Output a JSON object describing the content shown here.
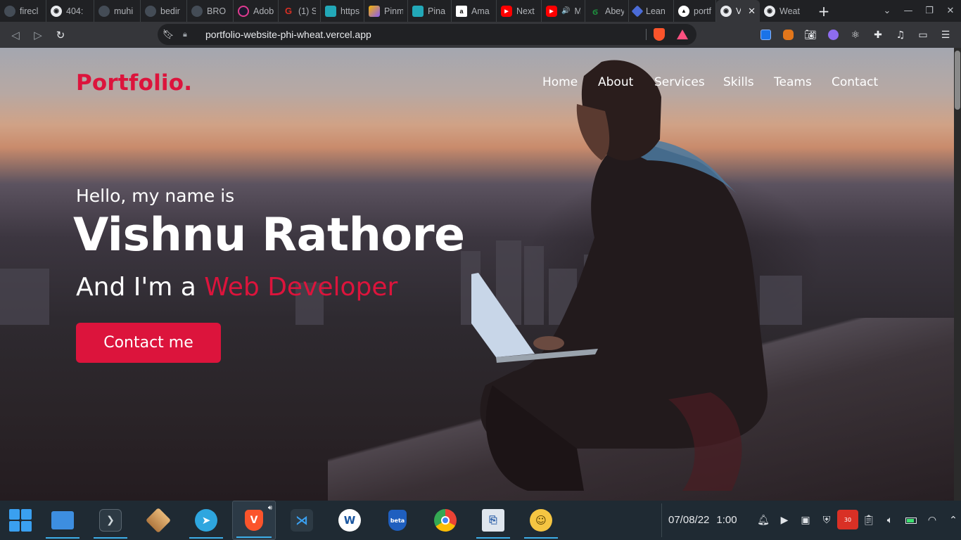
{
  "browser": {
    "tabs": [
      {
        "label": "firecl",
        "icon": "github-icon",
        "color": "#444c56"
      },
      {
        "label": "404:",
        "icon": "globe-icon",
        "color": "#5f6368"
      },
      {
        "label": "muhi",
        "icon": "github-icon",
        "color": "#444c56"
      },
      {
        "label": "bedir",
        "icon": "github-icon",
        "color": "#444c56"
      },
      {
        "label": "BRO",
        "icon": "github-icon",
        "color": "#444c56"
      },
      {
        "label": "Adob",
        "icon": "adobe-icon",
        "color": "#1a1a2e"
      },
      {
        "label": "(1) S",
        "icon": "g-icon",
        "color": "#d93025"
      },
      {
        "label": "https",
        "icon": "cube-icon",
        "color": "#22a8b8"
      },
      {
        "label": "Pinm",
        "icon": "pin-icon",
        "color": "#8a5cf6"
      },
      {
        "label": "Pina",
        "icon": "cube-icon",
        "color": "#22a8b8"
      },
      {
        "label": "Ama",
        "icon": "amazon-icon",
        "color": "#ffffff"
      },
      {
        "label": "Next",
        "icon": "youtube-icon",
        "color": "#ff0000"
      },
      {
        "label": "M",
        "icon": "youtube-icon",
        "color": "#ff0000"
      },
      {
        "label": "Abey",
        "icon": "leaf-icon",
        "color": "#1e8e3e"
      },
      {
        "label": "Lean",
        "icon": "diamond-icon",
        "color": "#4b6cd8"
      },
      {
        "label": "portf",
        "icon": "triangle-icon",
        "color": "#000000"
      },
      {
        "label": "V",
        "icon": "globe-icon",
        "color": "#5f6368",
        "active": true
      },
      {
        "label": "Weat",
        "icon": "globe-icon",
        "color": "#5f6368"
      }
    ],
    "new_tab": "+",
    "close_tab": "✕",
    "url": "portfolio-website-phi-wheat.vercel.app"
  },
  "site": {
    "logo": "Portfolio.",
    "nav": [
      "Home",
      "About",
      "Services",
      "Skills",
      "Teams",
      "Contact"
    ],
    "greeting": "Hello, my name is",
    "name": "Vishnu Rathore",
    "role_prefix": "And I'm a",
    "role_highlight": "Web Developer",
    "cta": "Contact me",
    "accent_color": "#dc143c"
  },
  "taskbar": {
    "apps": [
      {
        "name": "start-menu-icon"
      },
      {
        "name": "file-manager-icon"
      },
      {
        "name": "terminal-icon"
      },
      {
        "name": "box-app-icon"
      },
      {
        "name": "telegram-icon"
      },
      {
        "name": "brave-browser-icon"
      },
      {
        "name": "vscode-icon"
      },
      {
        "name": "logo-app-icon"
      },
      {
        "name": "brave-beta-icon"
      },
      {
        "name": "chrome-beta-icon"
      },
      {
        "name": "installer-icon"
      },
      {
        "name": "emoji-icon"
      }
    ],
    "date": "07/08/22",
    "time": "1:00",
    "notification_badge": "30"
  }
}
